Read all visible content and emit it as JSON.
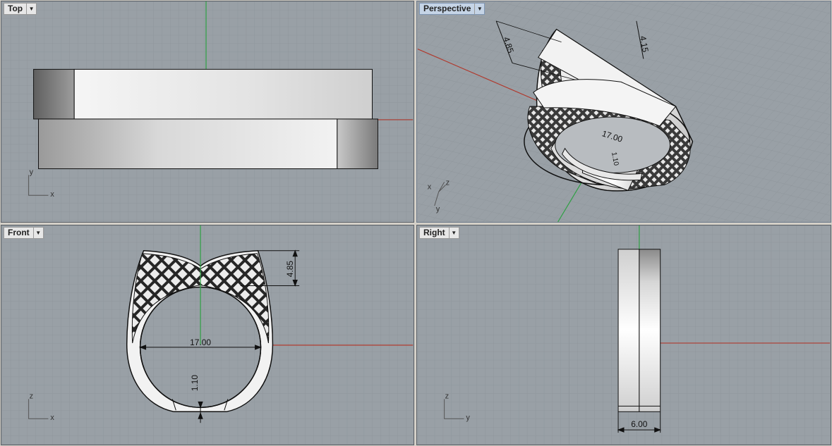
{
  "viewports": {
    "top": {
      "title": "Top",
      "axes": [
        "y",
        "x"
      ]
    },
    "perspective": {
      "title": "Perspective",
      "axes": [
        "z",
        "x",
        "y"
      ],
      "dims": [
        "4.85",
        "4.15",
        "17.00",
        "1.10"
      ]
    },
    "front": {
      "title": "Front",
      "axes": [
        "z",
        "x"
      ],
      "dims": {
        "height": "4.85",
        "diameter": "17.00",
        "thickness": "1.10"
      }
    },
    "right": {
      "title": "Right",
      "axes": [
        "z",
        "y"
      ],
      "dims": {
        "width": "6.00"
      }
    }
  },
  "menu_icon": "dropdown-arrow-icon",
  "colors": {
    "viewport_bg": "#99a0a6",
    "grid_minor": "#8f969c",
    "grid_major": "#7d848a",
    "x_axis": "#b03a2e",
    "y_axis": "#2ea043",
    "active_tab": "#c5d4e6"
  }
}
